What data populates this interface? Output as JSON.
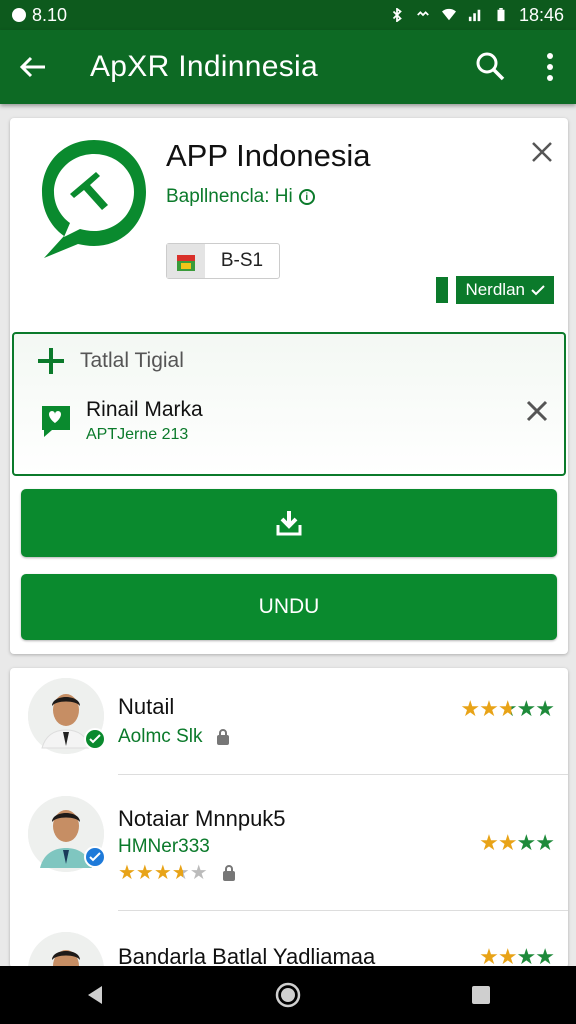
{
  "status_bar": {
    "time": "8.10",
    "clock": "18:46"
  },
  "app_bar": {
    "title": "ApXR Indinnesia",
    "back_icon": "arrow-left-icon",
    "search_icon": "search-icon",
    "more_icon": "more-vert-icon"
  },
  "app_card": {
    "name": "APP Indonesia",
    "subtitle": "Bapllnencla: Hi",
    "age_label": "B-S1",
    "verified_label": "Nerdlan",
    "trial": {
      "title": "Tatlal Tigial",
      "item_name": "Rinail Marka",
      "item_sub": "APTJerne 213"
    },
    "download_icon": "download-icon",
    "undu_label": "UNDU"
  },
  "reviews": [
    {
      "name": "Nutail",
      "sub": "Aolmc Slk",
      "stars": "★★★★★",
      "badge": "check-icon"
    },
    {
      "name": "Notaiar Mnnpuk5",
      "sub": "HMNer333",
      "sub_stars": "★★★★★",
      "stars": "★★★★",
      "badge": "verified-icon"
    },
    {
      "name": "Bandarla Batlal Yadliamaa",
      "stars": "★★★★"
    }
  ],
  "colors": {
    "primary_dark": "#0d5a1d",
    "primary": "#0d6a24",
    "accent": "#0a8a2e"
  }
}
